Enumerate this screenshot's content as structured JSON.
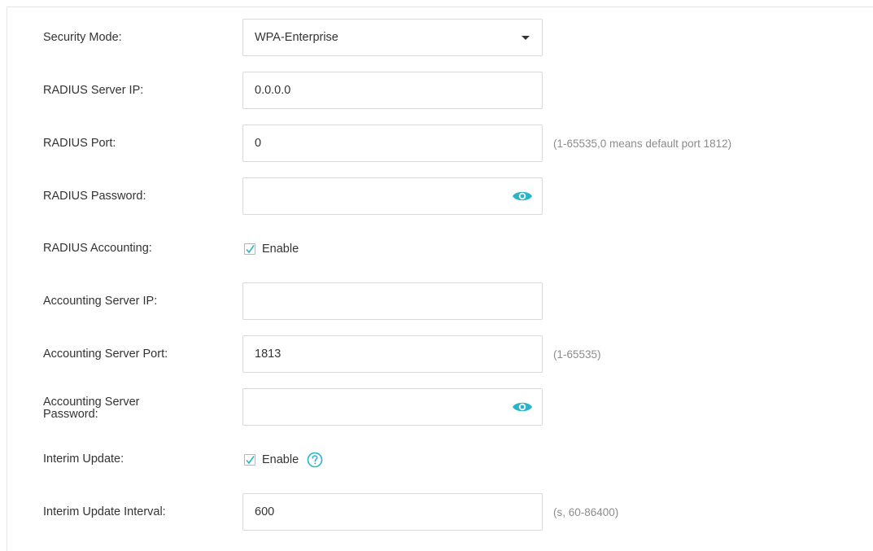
{
  "accent_color": "#27b5c7",
  "form": {
    "security_mode": {
      "label": "Security Mode:",
      "value": "WPA-Enterprise",
      "icon": "chevron-down-icon"
    },
    "radius_server_ip": {
      "label": "RADIUS Server IP:",
      "value": "0.0.0.0"
    },
    "radius_port": {
      "label": "RADIUS Port:",
      "value": "0",
      "hint": "(1-65535,0 means default port 1812)"
    },
    "radius_password": {
      "label": "RADIUS Password:",
      "value": "",
      "icon": "eye-icon"
    },
    "radius_accounting": {
      "label": "RADIUS Accounting:",
      "checkbox_label": "Enable",
      "checked": true
    },
    "accounting_server_ip": {
      "label": "Accounting Server IP:",
      "value": ""
    },
    "accounting_server_port": {
      "label": "Accounting Server Port:",
      "value": "1813",
      "hint": "(1-65535)"
    },
    "accounting_server_password": {
      "label_line1": "Accounting Server",
      "label_line2": "Password:",
      "value": "",
      "icon": "eye-icon"
    },
    "interim_update": {
      "label": "Interim Update:",
      "checkbox_label": "Enable",
      "checked": true,
      "help_icon": "question-circle-icon"
    },
    "interim_update_interval": {
      "label": "Interim Update Interval:",
      "value": "600",
      "hint": "(s, 60-86400)"
    }
  }
}
